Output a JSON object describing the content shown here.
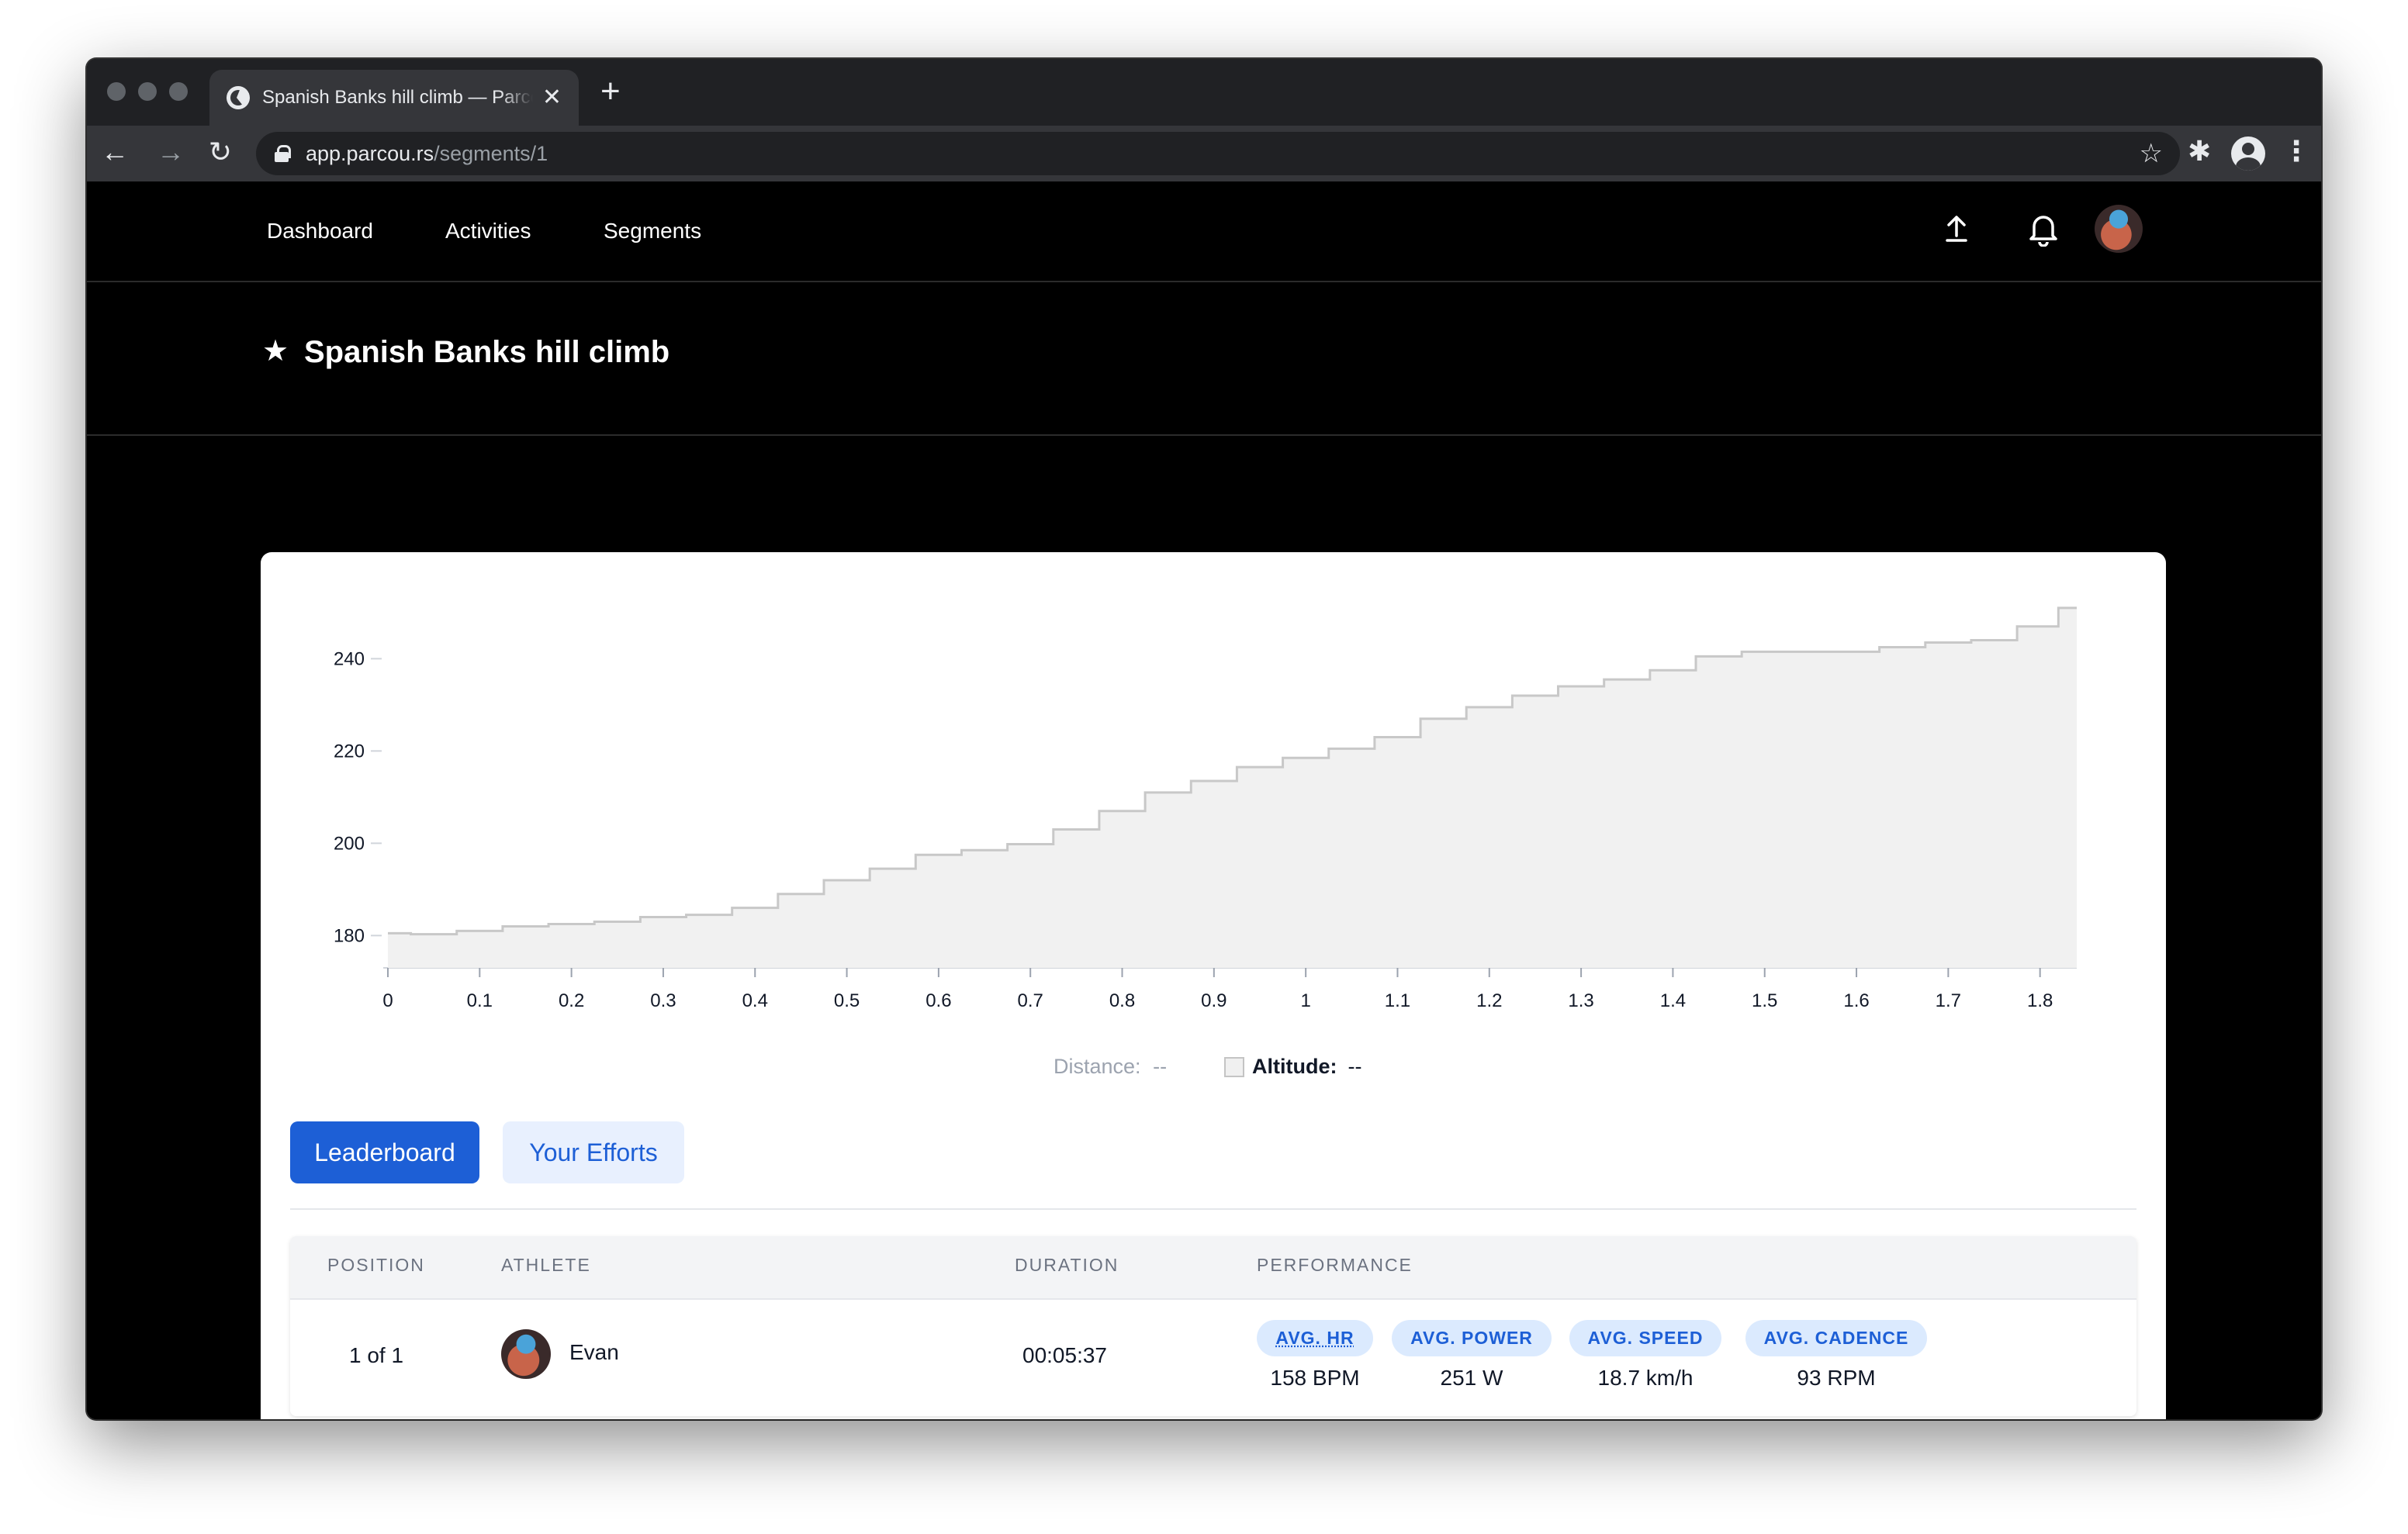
{
  "browser": {
    "tab_title": "Spanish Banks hill climb — Parcours",
    "tab_close": "✕",
    "new_tab": "+",
    "url_host": "app.parcou.rs",
    "url_path": "/segments/1",
    "back": "←",
    "forward": "→",
    "reload": "↻",
    "bookmark": "☆",
    "extensions": "✱",
    "menu": "⋮"
  },
  "nav": {
    "links": [
      "Dashboard",
      "Activities",
      "Segments"
    ],
    "icons": [
      "upload-icon",
      "bell-icon"
    ]
  },
  "segment": {
    "title": "Spanish Banks hill climb",
    "star": "★"
  },
  "readout": {
    "distance_label": "Distance:",
    "distance_value": "--",
    "altitude_label": "Altitude:",
    "altitude_value": "--"
  },
  "tabs": {
    "leaderboard": "Leaderboard",
    "your_efforts": "Your Efforts"
  },
  "table": {
    "headers": {
      "position": "POSITION",
      "athlete": "ATHLETE",
      "duration": "DURATION",
      "performance": "PERFORMANCE"
    },
    "rows": [
      {
        "position": "1 of 1",
        "athlete": "Evan",
        "duration": "00:05:37",
        "stats": [
          {
            "label": "AVG. HR",
            "value": "158 BPM"
          },
          {
            "label": "AVG. POWER",
            "value": "251 W"
          },
          {
            "label": "AVG. SPEED",
            "value": "18.7 km/h"
          },
          {
            "label": "AVG. CADENCE",
            "value": "93 RPM"
          }
        ]
      }
    ]
  },
  "colors": {
    "accent": "#1d5fd6",
    "accent_light": "#dbeafe",
    "area_fill": "#f1f1f1",
    "area_stroke": "#c8c8c8"
  },
  "chart_data": {
    "type": "area",
    "title": "",
    "xlabel": "",
    "ylabel": "",
    "xlim": [
      0,
      1.84
    ],
    "ylim": [
      173,
      253
    ],
    "x_ticks": [
      "0",
      "0.1",
      "0.2",
      "0.3",
      "0.4",
      "0.5",
      "0.6",
      "0.7",
      "0.8",
      "0.9",
      "1",
      "1.1",
      "1.2",
      "1.3",
      "1.4",
      "1.5",
      "1.6",
      "1.7",
      "1.8"
    ],
    "y_ticks": [
      "180",
      "200",
      "220",
      "240"
    ],
    "grid": false,
    "series": [
      {
        "x": [
          0,
          0.05,
          0.1,
          0.15,
          0.2,
          0.25,
          0.3,
          0.35,
          0.4,
          0.45,
          0.5,
          0.55,
          0.6,
          0.65,
          0.7,
          0.75,
          0.8,
          0.85,
          0.9,
          0.95,
          1.0,
          1.05,
          1.1,
          1.15,
          1.2,
          1.25,
          1.3,
          1.35,
          1.4,
          1.45,
          1.5,
          1.55,
          1.6,
          1.65,
          1.7,
          1.75,
          1.8,
          1.84
        ],
        "y": [
          180.5,
          180.3,
          181.0,
          182.0,
          182.5,
          183.0,
          184.0,
          184.5,
          186.0,
          189.0,
          192.0,
          194.5,
          197.5,
          198.5,
          199.8,
          203.0,
          207.0,
          211.0,
          213.5,
          216.5,
          218.5,
          220.5,
          223.0,
          227.0,
          229.5,
          232.0,
          234.0,
          235.5,
          237.5,
          240.5,
          241.5,
          241.5,
          241.5,
          242.5,
          243.5,
          244.0,
          247.0,
          251.0
        ]
      }
    ]
  }
}
